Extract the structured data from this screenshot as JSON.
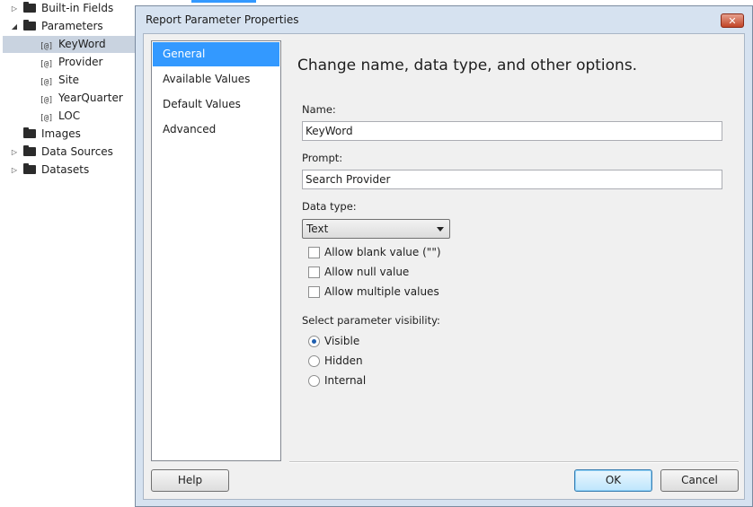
{
  "tree": {
    "items": [
      {
        "label": "Built-in Fields"
      },
      {
        "label": "Parameters"
      },
      {
        "label": "KeyWord"
      },
      {
        "label": "Provider"
      },
      {
        "label": "Site"
      },
      {
        "label": "YearQuarter"
      },
      {
        "label": "LOC"
      },
      {
        "label": "Images"
      },
      {
        "label": "Data Sources"
      },
      {
        "label": "Datasets"
      }
    ],
    "param_icon": "[@]"
  },
  "dialog": {
    "title": "Report Parameter Properties",
    "close_glyph": "✕",
    "nav": [
      "General",
      "Available Values",
      "Default Values",
      "Advanced"
    ],
    "heading": "Change name, data type, and other options.",
    "name_label": "Name:",
    "name_value": "KeyWord",
    "prompt_label": "Prompt:",
    "prompt_value": "Search Provider",
    "datatype_label": "Data type:",
    "datatype_value": "Text",
    "checkboxes": [
      {
        "label": "Allow blank value (\"\")",
        "checked": false
      },
      {
        "label": "Allow null value",
        "checked": false
      },
      {
        "label": "Allow multiple values",
        "checked": false
      }
    ],
    "visibility_label": "Select parameter visibility:",
    "visibility_options": [
      {
        "label": "Visible",
        "selected": true
      },
      {
        "label": "Hidden",
        "selected": false
      },
      {
        "label": "Internal",
        "selected": false
      }
    ],
    "buttons": {
      "help": "Help",
      "ok": "OK",
      "cancel": "Cancel"
    }
  },
  "colors": {
    "selection": "#3399ff",
    "tree_selection": "#c9d3e0",
    "dialog_frame": "#d6e2f0"
  },
  "icons": {
    "folder": "folder-icon",
    "expand": "expand-arrow-icon",
    "collapse": "collapse-arrow-icon",
    "parameter": "parameter-icon",
    "close": "close-icon",
    "dropdown": "chevron-down-icon"
  }
}
